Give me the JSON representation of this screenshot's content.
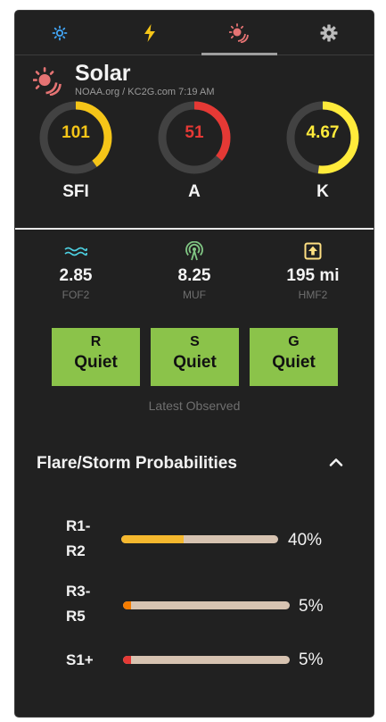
{
  "tabs": [
    {
      "name": "tab-sun",
      "icon": "sun-icon",
      "active": false
    },
    {
      "name": "tab-lightning",
      "icon": "lightning-icon",
      "active": false
    },
    {
      "name": "tab-solar",
      "icon": "solar-activity-icon",
      "active": true
    },
    {
      "name": "tab-settings",
      "icon": "gear-icon",
      "active": false
    }
  ],
  "header": {
    "title": "Solar",
    "subtitle": "NOAA.org / KC2G.com 7:19 AM"
  },
  "gauges": [
    {
      "label": "SFI",
      "value": "101",
      "level": 0.4,
      "color": "#f5c518"
    },
    {
      "label": "A",
      "value": "51",
      "level": 0.36,
      "color": "#e53935"
    },
    {
      "label": "K",
      "value": "4.67",
      "level": 0.52,
      "color": "#ffeb3b"
    }
  ],
  "metrics": [
    {
      "label": "FOF2",
      "value": "2.85",
      "icon": "wave-icon",
      "color": "#4dd0e1"
    },
    {
      "label": "MUF",
      "value": "8.25",
      "icon": "antenna-icon",
      "color": "#81c784"
    },
    {
      "label": "HMF2",
      "value": "195 mi",
      "icon": "upload-box-icon",
      "color": "#ffe082"
    }
  ],
  "scales": [
    {
      "letter": "R",
      "status": "Quiet"
    },
    {
      "letter": "S",
      "status": "Quiet"
    },
    {
      "letter": "G",
      "status": "Quiet"
    }
  ],
  "observed": "Latest Observed",
  "probabilities": {
    "heading": "Flare/Storm Probabilities",
    "rows": [
      {
        "label": "R1-\nR2",
        "line1": "R1-",
        "line2": "R2",
        "value": "40%",
        "level": 0.4,
        "color": "#f5b82e"
      },
      {
        "label": "R3-\nR5",
        "line1": "R3-",
        "line2": "R5",
        "value": "5%",
        "level": 0.05,
        "color": "#f57c00"
      },
      {
        "label": "S1+",
        "line1": "S1+",
        "line2": "",
        "value": "5%",
        "level": 0.05,
        "color": "#e53935"
      }
    ]
  },
  "colors": {
    "panel": "#212121",
    "scale_green": "#8bc34a",
    "track": "#d7c3b1"
  }
}
